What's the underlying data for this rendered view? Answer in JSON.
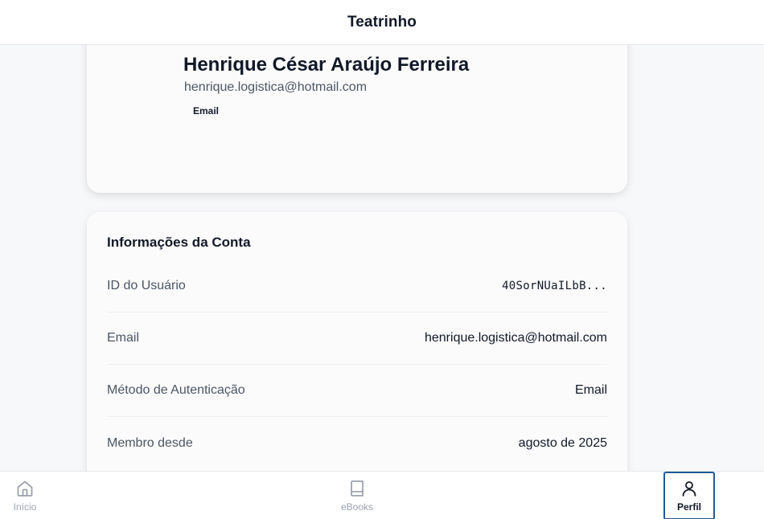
{
  "header": {
    "title": "Teatrinho"
  },
  "profile": {
    "name": "Henrique César Araújo Ferreira",
    "email": "henrique.logistica@hotmail.com",
    "auth_badge": "Email"
  },
  "account_info": {
    "title": "Informações da Conta",
    "rows": [
      {
        "label": "ID do Usuário",
        "value": "40SorNUaILbB..."
      },
      {
        "label": "Email",
        "value": "henrique.logistica@hotmail.com"
      },
      {
        "label": "Método de Autenticação",
        "value": "Email"
      },
      {
        "label": "Membro desde",
        "value": "agosto de 2025"
      }
    ]
  },
  "bottom_nav": {
    "items": [
      {
        "label": "Início",
        "icon": "home-icon",
        "active": false
      },
      {
        "label": "eBooks",
        "icon": "book-icon",
        "active": false
      },
      {
        "label": "Perfil",
        "icon": "user-icon",
        "active": true
      }
    ]
  },
  "colors": {
    "active_outline": "#1e5a96",
    "inactive_nav": "#9ca3af",
    "background": "#f7f8fa"
  }
}
